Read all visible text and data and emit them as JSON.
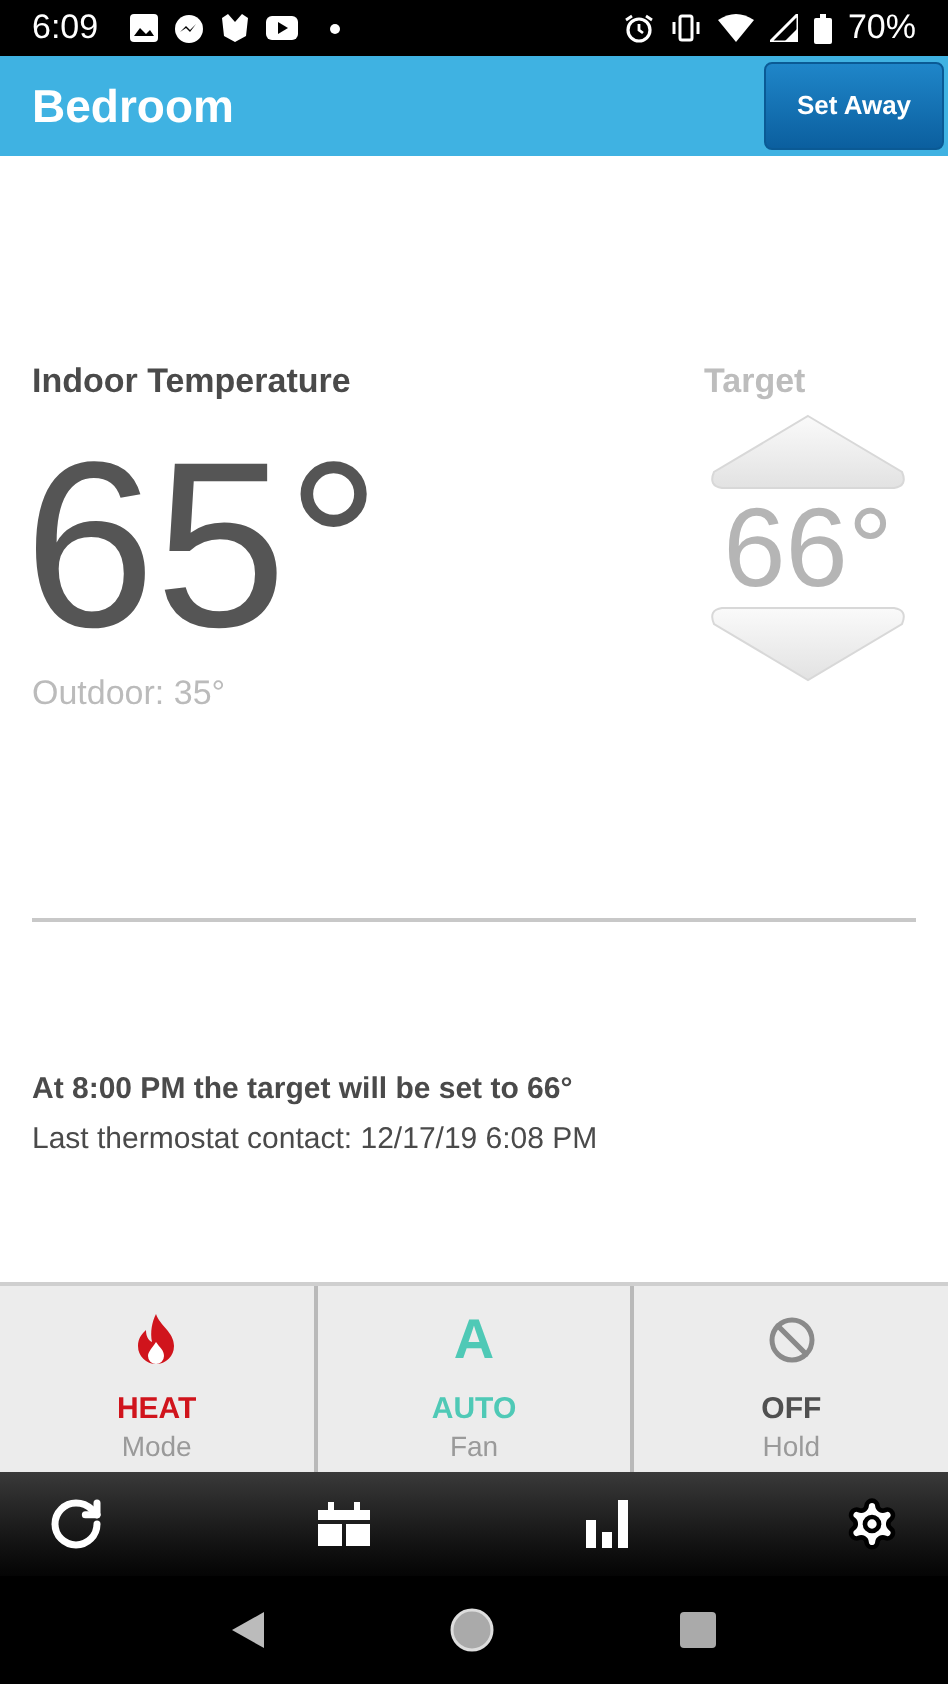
{
  "status_bar": {
    "time": "6:09",
    "battery": "70%"
  },
  "header": {
    "title": "Bedroom",
    "button": "Set Away"
  },
  "indoor": {
    "label": "Indoor Temperature",
    "value": "65°",
    "outdoor": "Outdoor: 35°"
  },
  "target": {
    "label": "Target",
    "value": "66°"
  },
  "schedule": {
    "next": "At 8:00 PM the target will be set to 66°",
    "last_contact": "Last thermostat contact: 12/17/19 6:08 PM"
  },
  "tiles": [
    {
      "kind": "flame",
      "value": "HEAT",
      "label": "Mode",
      "color": "#d0141c"
    },
    {
      "kind": "letter",
      "glyph": "A",
      "value": "AUTO",
      "label": "Fan",
      "color": "#4fc9b6"
    },
    {
      "kind": "blocked",
      "value": "OFF",
      "label": "Hold",
      "color": "#505050"
    }
  ],
  "toolbar": [
    {
      "kind": "refresh"
    },
    {
      "kind": "schedule"
    },
    {
      "kind": "chart"
    },
    {
      "kind": "settings"
    }
  ]
}
